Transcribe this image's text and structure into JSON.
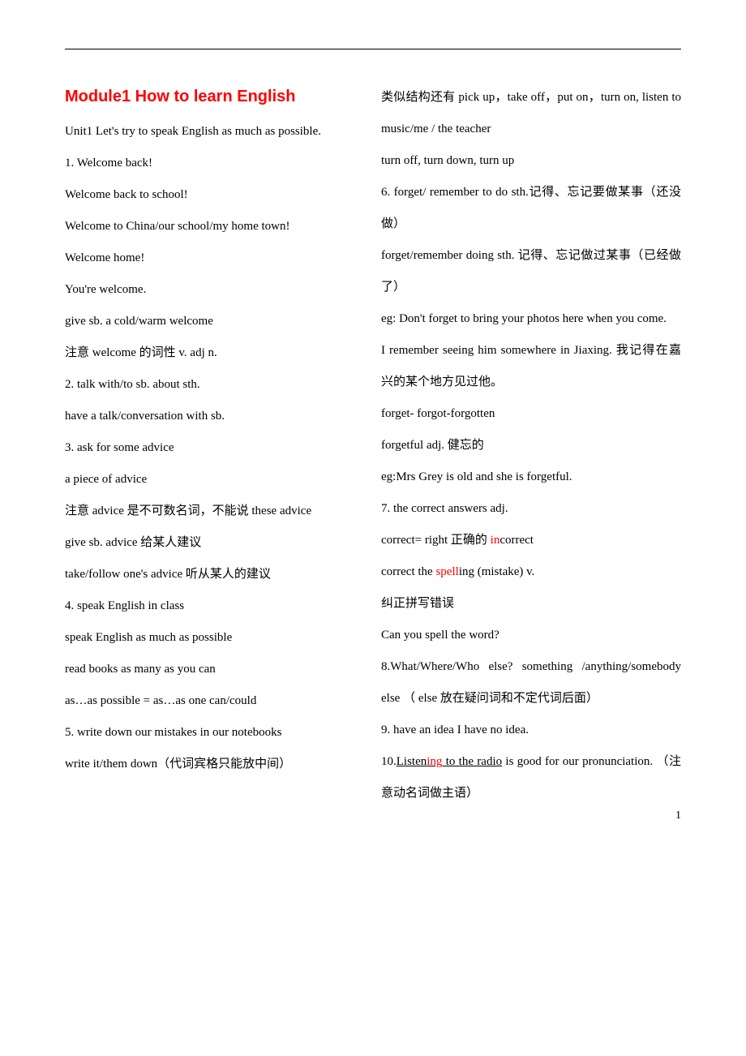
{
  "title": "Module1 How to learn English",
  "col1": [
    "Unit1 Let's try to speak English as much as possible.",
    "1.  Welcome back!",
    "Welcome back to school!",
    "Welcome to China/our school/my home town!",
    "Welcome home!",
    "You're welcome.",
    "give sb. a cold/warm welcome",
    "注意 welcome 的词性 v.   adj   n.",
    "2.  talk with/to sb. about sth.",
    "have a talk/conversation with sb.",
    "3. ask for some advice",
    " a piece of advice",
    "注意 advice 是不可数名词，不能说 these advice",
    "give sb. advice 给某人建议",
    "take/follow one's advice 听从某人的建议",
    "4. speak English in class",
    "speak English as much as possible",
    "read books as many as you can",
    "as…as possible = as…as one can/could",
    "5. write down our mistakes in our notebooks",
    "write it/them down（代词宾格只能放中间）"
  ],
  "span_line": "类似结构还有 pick up，take off，put on，turn on, listen to music/me / the teacher",
  "col2_pre": "turn off, turn down, turn up",
  "col2": [
    "6. forget/ remember to do sth.记得、忘记要做某事（还没做）",
    "forget/remember doing sth. 记得、忘记做过某事（已经做了）",
    "eg: Don't forget to bring your photos here when you come.",
    "I remember seeing him somewhere in Jiaxing. 我记得在嘉兴的某个地方见过他。",
    " forget- forgot-forgotten",
    " forgetful  adj. 健忘的",
    "eg:Mrs Grey is old and she is forgetful.",
    "7. the correct answers  adj."
  ],
  "line_correct": {
    "a": "correct= right 正确的    ",
    "in": "in",
    "b": "correct"
  },
  "line_spell": {
    "a": " correct the ",
    "s": "spell",
    "b": "ing (mistake) v."
  },
  "col2b": [
    " 纠正拼写错误",
    " Can you spell the word?",
    "8.What/Where/Who else?         something /anything/somebody else （ else 放在疑问词和不定代词后面）",
    "9. have an idea      I have no idea."
  ],
  "line_listen": {
    "a": "10.",
    "u": "Listen",
    "r": "ing",
    "u2": " to the radio",
    "b": " is good for our pronunciation. （注意动名词做主语）"
  },
  "page_number": "1"
}
